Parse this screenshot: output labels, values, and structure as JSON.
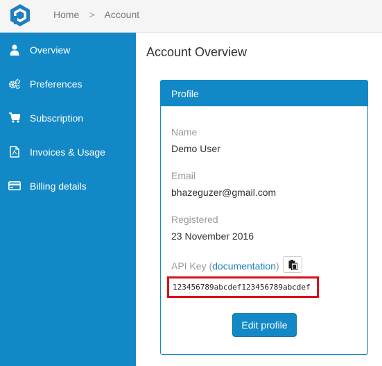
{
  "breadcrumb": {
    "home": "Home",
    "separator": ">",
    "current": "Account"
  },
  "sidebar": {
    "items": [
      {
        "label": "Overview",
        "icon": "user-icon"
      },
      {
        "label": "Preferences",
        "icon": "cogs-icon"
      },
      {
        "label": "Subscription",
        "icon": "cart-icon"
      },
      {
        "label": "Invoices & Usage",
        "icon": "pdf-file-icon"
      },
      {
        "label": "Billing details",
        "icon": "credit-card-icon"
      }
    ]
  },
  "main": {
    "title": "Account Overview",
    "panel": {
      "title": "Profile",
      "name_label": "Name",
      "name_value": "Demo User",
      "email_label": "Email",
      "email_value": "bhazeguzer@gmail.com",
      "registered_label": "Registered",
      "registered_value": "23 November 2016",
      "apikey_label_prefix": "API Key (",
      "apikey_doc_link": "documentation",
      "apikey_label_suffix": ")",
      "apikey_value": "123456789abcdef123456789abcdef",
      "edit_button": "Edit profile"
    }
  },
  "colors": {
    "accent": "#1289c6",
    "highlight": "#d8111a"
  }
}
